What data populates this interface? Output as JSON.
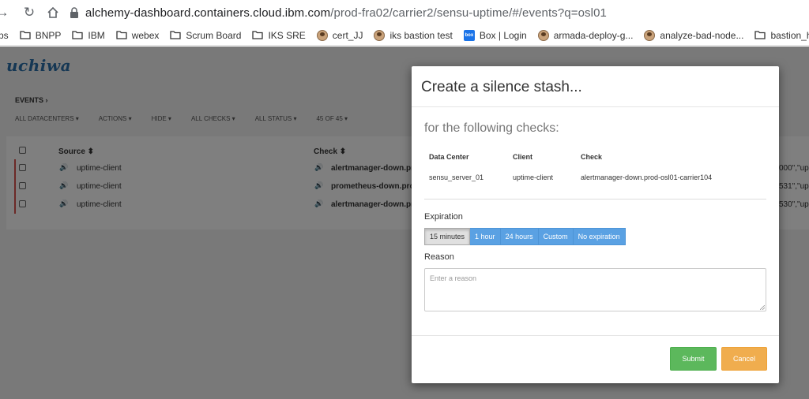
{
  "browser": {
    "url_host": "alchemy-dashboard.containers.cloud.ibm.com",
    "url_path": "/prod-fra02/carrier2/sensu-uptime/#/events?q=osl01",
    "bookmarks": [
      {
        "label": "ps",
        "icon": "none"
      },
      {
        "label": "BNPP",
        "icon": "folder-icon"
      },
      {
        "label": "IBM",
        "icon": "folder-icon"
      },
      {
        "label": "webex",
        "icon": "folder-icon"
      },
      {
        "label": "Scrum Board",
        "icon": "folder-icon"
      },
      {
        "label": "IKS SRE",
        "icon": "folder-icon"
      },
      {
        "label": "cert_JJ",
        "icon": "avatar-icon"
      },
      {
        "label": "iks bastion test",
        "icon": "avatar-icon"
      },
      {
        "label": "Box | Login",
        "icon": "box-icon"
      },
      {
        "label": "armada-deploy-g...",
        "icon": "avatar-icon"
      },
      {
        "label": "analyze-bad-node...",
        "icon": "avatar-icon"
      },
      {
        "label": "bastion_host",
        "icon": "folder-icon"
      }
    ],
    "box_icon_text": "box"
  },
  "app": {
    "logo": "uchiwa",
    "breadcrumb": "EVENTS",
    "breadcrumb_arrow": "›",
    "filters": [
      "ALL DATACENTERS ▾",
      "ACTIONS ▾",
      "HIDE ▾",
      "ALL CHECKS ▾",
      "ALL STATUS ▾",
      "45 OF 45 ▾"
    ],
    "table": {
      "headers": {
        "source": "Source ⬍",
        "check": "Check ⬍"
      },
      "rows": [
        {
          "source": "uptime-client",
          "check": "alertmanager-down.pr",
          "output": "000\",\"ups"
        },
        {
          "source": "uptime-client",
          "check": "prometheus-down.pro",
          "output": "531\",\"ups"
        },
        {
          "source": "uptime-client",
          "check": "alertmanager-down.pr",
          "output": "530\",\"ups"
        }
      ],
      "status_color": "#d9534f"
    }
  },
  "modal": {
    "title": "Create a silence stash...",
    "subtitle": "for the following checks:",
    "columns": [
      "Data Center",
      "Client",
      "Check"
    ],
    "row": {
      "datacenter": "sensu_server_01",
      "client": "uptime-client",
      "check": "alertmanager-down.prod-osl01-carrier104"
    },
    "expiration_label": "Expiration",
    "expiration_options": [
      "15 minutes",
      "1 hour",
      "24 hours",
      "Custom",
      "No expiration"
    ],
    "expiration_selected": "15 minutes",
    "reason_label": "Reason",
    "reason_placeholder": "Enter a reason",
    "submit_label": "Submit",
    "cancel_label": "Cancel",
    "colors": {
      "submit": "#5cb85c",
      "cancel": "#f0ad4e",
      "option": "#5aa1e3"
    }
  }
}
